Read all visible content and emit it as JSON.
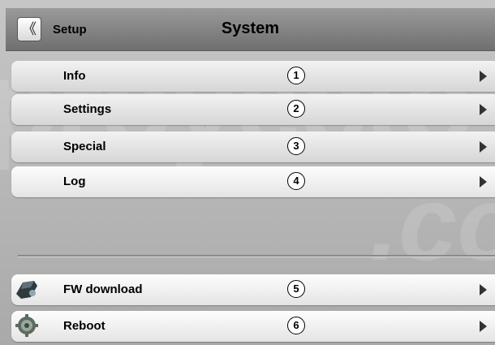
{
  "header": {
    "back_label": "《",
    "setup_label": "Setup",
    "title": "System"
  },
  "menu": [
    {
      "label": "Info",
      "number": "1"
    },
    {
      "label": "Settings",
      "number": "2"
    },
    {
      "label": "Special",
      "number": "3"
    },
    {
      "label": "Log",
      "number": "4"
    }
  ],
  "actions": [
    {
      "label": "FW download",
      "number": "5",
      "icon": "fw-download-icon"
    },
    {
      "label": "Reboot",
      "number": "6",
      "icon": "reboot-gear-icon"
    }
  ]
}
